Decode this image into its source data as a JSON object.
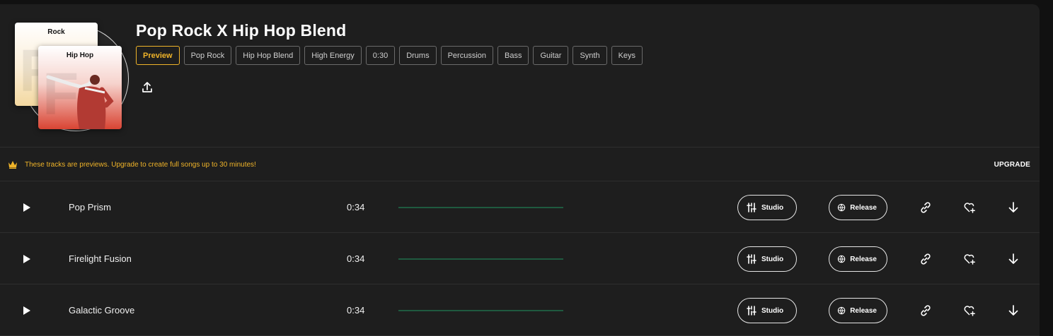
{
  "playlist": {
    "title": "Pop Rock X Hip Hop Blend",
    "art": {
      "card_back_label": "Rock",
      "card_front_label": "Hip Hop"
    },
    "tags": [
      "Preview",
      "Pop Rock",
      "Hip Hop Blend",
      "High Energy",
      "0:30",
      "Drums",
      "Percussion",
      "Bass",
      "Guitar",
      "Synth",
      "Keys"
    ],
    "active_tag": "Preview"
  },
  "banner": {
    "message": "These tracks are previews. Upgrade to create full songs up to 30 minutes!",
    "upgrade_label": "UPGRADE",
    "accent_color": "#f0b429"
  },
  "actions": {
    "studio_label": "Studio",
    "release_label": "Release"
  },
  "tracks": [
    {
      "name": "Pop Prism",
      "duration": "0:34"
    },
    {
      "name": "Firelight Fusion",
      "duration": "0:34"
    },
    {
      "name": "Galactic Groove",
      "duration": "0:34"
    }
  ],
  "icons": [
    "share-icon",
    "crown-icon",
    "play-icon",
    "sliders-icon",
    "globe-icon",
    "link-icon",
    "heart-plus-icon",
    "download-icon"
  ]
}
